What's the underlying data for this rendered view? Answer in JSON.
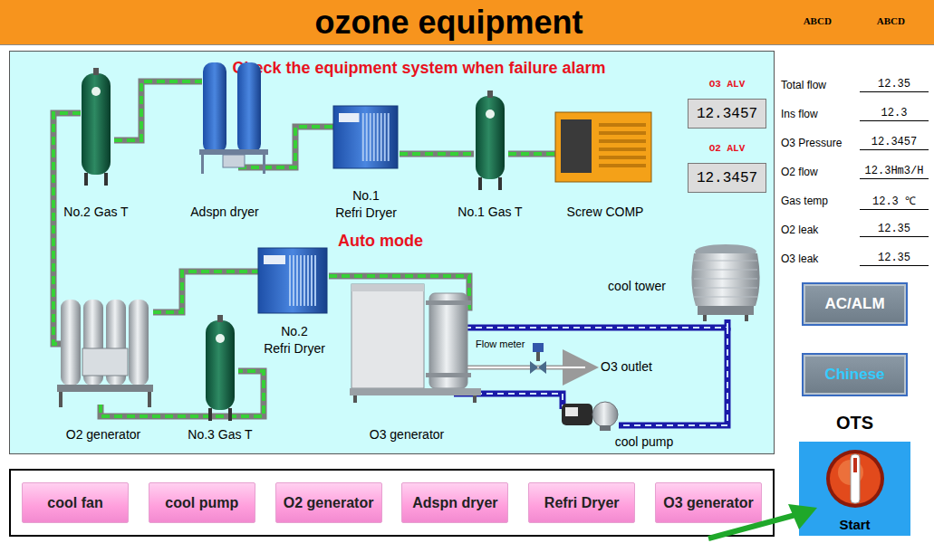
{
  "window": {
    "title": "ozone equipment",
    "header_codes": [
      "ABCD",
      "ABCD"
    ]
  },
  "diagram": {
    "alert": "Check the equipment system when failure alarm",
    "mode": "Auto mode",
    "equipment": [
      {
        "lines": [
          "No.2 Gas T"
        ],
        "kind": "tank"
      },
      {
        "lines": [
          "Adspn dryer"
        ],
        "kind": "adsorption"
      },
      {
        "lines": [
          "No.1",
          "Refri Dryer"
        ],
        "kind": "refri"
      },
      {
        "lines": [
          "No.1 Gas T"
        ],
        "kind": "tank"
      },
      {
        "lines": [
          "Screw COMP"
        ],
        "kind": "compressor"
      },
      {
        "lines": [
          "cool tower"
        ],
        "kind": "tower"
      },
      {
        "lines": [
          "No.2",
          "Refri Dryer"
        ],
        "kind": "refri"
      },
      {
        "lines": [
          "O2 generator"
        ],
        "kind": "o2gen"
      },
      {
        "lines": [
          "No.3 Gas T"
        ],
        "kind": "tank"
      },
      {
        "lines": [
          "O3 generator"
        ],
        "kind": "o3gen"
      },
      {
        "lines": [
          "cool pump"
        ],
        "kind": "pump"
      }
    ],
    "alarms": [
      {
        "label": "O3 ALV",
        "value": "12.3457"
      },
      {
        "label": "O2 ALV",
        "value": "12.3457"
      }
    ],
    "flow_meter": "Flow meter",
    "outlet": "O3 outlet"
  },
  "readings": [
    {
      "label": "Total flow",
      "value": "12.35"
    },
    {
      "label": "Ins flow",
      "value": "12.3"
    },
    {
      "label": "O3 Pressure",
      "value": "12.3457"
    },
    {
      "label": "O2 flow",
      "value": "12.3Hm3/H"
    },
    {
      "label": "Gas temp",
      "value": "12.3 ℃"
    },
    {
      "label": "O2 leak",
      "value": "12.35"
    },
    {
      "label": "O3 leak",
      "value": "12.35"
    }
  ],
  "side_buttons": [
    "AC/ALM",
    "Chinese"
  ],
  "ots": {
    "title": "OTS",
    "switch_label": "Start"
  },
  "control_buttons": [
    "cool fan",
    "cool pump",
    "O2 generator",
    "Adspn dryer",
    "Refri Dryer",
    "O3 generator"
  ]
}
